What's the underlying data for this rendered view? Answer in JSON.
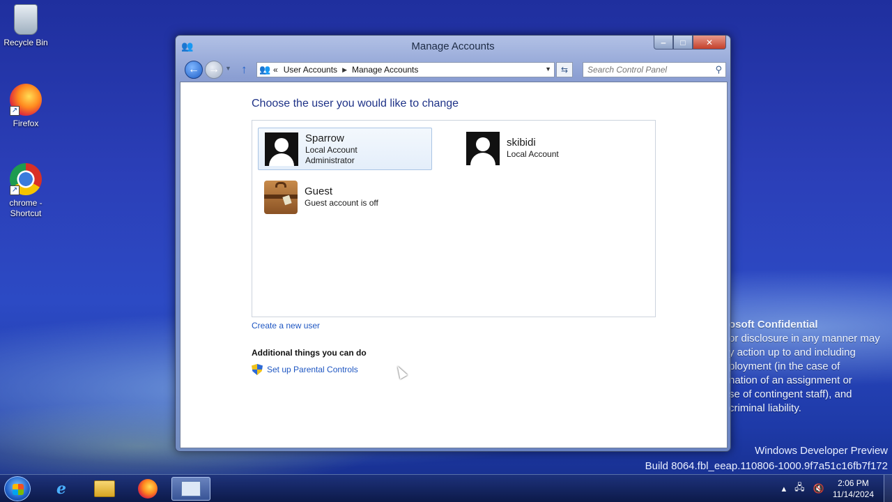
{
  "desktop": {
    "icons": [
      {
        "label": "Recycle Bin"
      },
      {
        "label": "Firefox"
      },
      {
        "label": "chrome - Shortcut"
      }
    ],
    "watermark": {
      "title": "osoft Confidential",
      "lines": [
        "or disclosure in any manner may",
        "y action up to and including",
        "ployment (in the case of",
        "nation of an assignment or",
        "se of contingent staff), and",
        "criminal liability."
      ]
    },
    "build": {
      "line1": "Windows Developer Preview",
      "line2": "Build 8064.fbl_eeap.110806-1000.9f7a51c16fb7f172"
    }
  },
  "window": {
    "title": "Manage Accounts",
    "caption": {
      "minimize": "‒",
      "maximize": "□",
      "close": "✕"
    },
    "nav": {
      "back": "←",
      "forward": "→",
      "history": "▼",
      "up": "↑",
      "breadcrumb_sep": "«",
      "crumbs": [
        "User Accounts",
        "Manage Accounts"
      ],
      "crumb_arrow": "▶",
      "dropdown": "▼",
      "refresh": "⇆"
    },
    "search": {
      "placeholder": "Search Control Panel",
      "icon": "⚲"
    },
    "content": {
      "heading": "Choose the user you would like to change",
      "accounts": [
        {
          "name": "Sparrow",
          "lines": [
            "Local Account",
            "Administrator"
          ],
          "selected": true
        },
        {
          "name": "skibidi",
          "lines": [
            "Local Account"
          ],
          "selected": false
        },
        {
          "name": "Guest",
          "lines": [
            "Guest account is off"
          ],
          "selected": false
        }
      ],
      "create_link": "Create a new user",
      "additional_heading": "Additional things you can do",
      "parental_link": "Set up Parental Controls"
    }
  },
  "taskbar": {
    "ie_glyph": "e",
    "tray": {
      "overflow": "▴",
      "network": "🖧",
      "volume": "🔇"
    },
    "clock": {
      "time": "2:06 PM",
      "date": "11/14/2024"
    }
  },
  "colors": {
    "link": "#1e56c2",
    "heading": "#1e3287",
    "selection": "#e4eefa"
  }
}
